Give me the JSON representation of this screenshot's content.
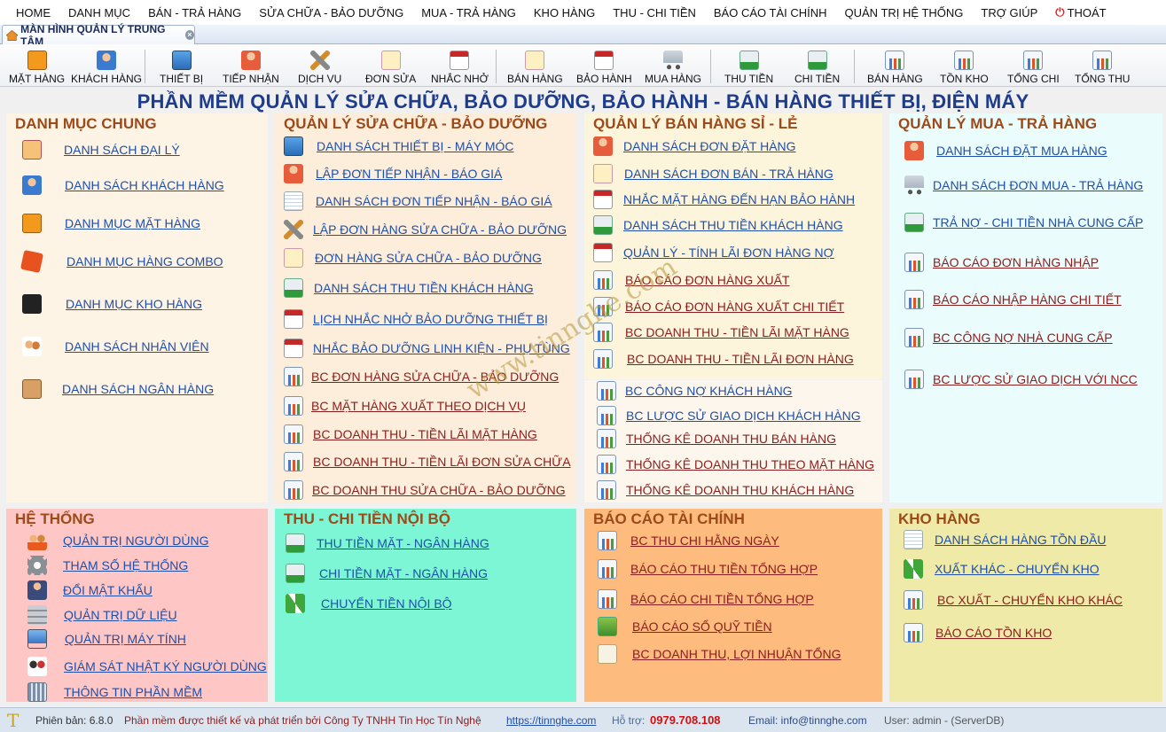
{
  "menu": [
    "HOME",
    "DANH MỤC",
    "BÁN - TRẢ HÀNG",
    "SỬA CHỮA - BẢO DƯỠNG",
    "MUA - TRẢ HÀNG",
    "KHO HÀNG",
    "THU - CHI TIỀN",
    "BÁO CÁO TÀI CHÍNH",
    "QUẢN TRỊ HỆ THỐNG",
    "TRỢ GIÚP",
    "THOÁT"
  ],
  "tab": {
    "title": "MÀN HÌNH QUẢN LÝ TRUNG TÂM",
    "close": "×"
  },
  "toolbar": [
    "MẶT HÀNG",
    "KHÁCH HÀNG",
    "THIẾT BỊ",
    "TIẾP NHẬN",
    "DỊCH VỤ",
    "ĐƠN SỬA",
    "NHẮC NHỞ",
    "BÁN HÀNG",
    "BẢO HÀNH",
    "MUA HÀNG",
    "THU TIỀN",
    "CHI TIỀN",
    "BÁN HÀNG",
    "TỒN KHO",
    "TỔNG CHI",
    "TỔNG THU"
  ],
  "main_title": "PHẦN MỀM QUẢN LÝ SỬA CHỮA, BẢO DƯỠNG, BẢO HÀNH - BÁN HÀNG THIẾT BỊ, ĐIỆN MÁY",
  "panels": {
    "danhmuc": {
      "title": "DANH MỤC CHUNG",
      "items": [
        "DANH SÁCH ĐẠI LÝ",
        "DANH SÁCH KHÁCH HÀNG",
        "DANH MỤC MẶT HÀNG",
        "DANH MỤC HÀNG COMBO",
        "DANH MỤC KHO HÀNG",
        "DANH SÁCH NHÂN VIÊN",
        "DANH SÁCH NGÂN HÀNG"
      ]
    },
    "suachua": {
      "title": "QUẢN LÝ SỬA CHỮA - BẢO DƯỠNG",
      "items": [
        "DANH SÁCH THIẾT BỊ - MÁY MÓC",
        "LẬP ĐƠN TIẾP NHẬN - BÁO GIÁ",
        "DANH SÁCH ĐƠN TIẾP NHẬN - BÁO GIÁ",
        "LẬP ĐƠN HÀNG SỬA CHỮA - BẢO DƯỠNG",
        "ĐƠN HÀNG SỬA CHỮA - BẢO DƯỠNG",
        "DANH SÁCH THU TIỀN KHÁCH HÀNG",
        "LỊCH NHẮC NHỞ BẢO DƯỠNG THIẾT BỊ",
        "NHẮC BẢO DƯỠNG LINH KIỆN - PHỤ TÙNG",
        "BC ĐƠN HÀNG SỬA CHỮA - BẢO DƯỠNG",
        "BC MẶT HÀNG XUẤT THEO DỊCH VỤ",
        "BC DOANH THU - TIỀN LÃI MẶT HÀNG",
        "BC DOANH THU - TIỀN LÃI ĐƠN SỬA CHỮA",
        "BC DOANH THU SỬA CHỮA - BẢO DƯỠNG"
      ]
    },
    "banhang": {
      "title": "QUẢN LÝ BÁN HÀNG SỈ - LẺ",
      "items": [
        "DANH SÁCH ĐƠN ĐẶT HÀNG",
        "DANH SÁCH ĐƠN BÁN - TRẢ HÀNG",
        "NHẮC MẶT HÀNG ĐẾN HẠN BẢO HÀNH",
        "DANH SÁCH THU TIỀN KHÁCH HÀNG",
        "QUẢN LÝ - TÍNH LÃI ĐƠN HÀNG NỢ",
        "BÁO CÁO ĐƠN HÀNG XUẤT",
        "BÁO CÁO ĐƠN HÀNG XUẤT CHI TIẾT",
        "BC DOANH THU - TIỀN LÃI MẶT HÀNG",
        "BC DOANH THU - TIỀN LÃI ĐƠN HÀNG",
        "BC CÔNG NỢ KHÁCH HÀNG",
        "BC LƯỢC SỬ GIAO DỊCH KHÁCH HÀNG",
        "THỐNG KÊ DOANH THU BÁN HÀNG",
        "THỐNG KÊ DOANH THU THEO MẶT HÀNG",
        "THỐNG KÊ DOANH THU KHÁCH HÀNG"
      ]
    },
    "muahang": {
      "title": "QUẢN LÝ MUA - TRẢ HÀNG",
      "items": [
        "DANH SÁCH ĐẶT MUA HÀNG",
        "DANH SÁCH ĐƠN MUA - TRẢ HÀNG",
        "TRẢ NỢ - CHI TIỀN NHÀ CUNG CẤP",
        "BÁO CÁO ĐƠN HÀNG NHẬP",
        "BÁO CÁO NHẬP HÀNG CHI TIẾT",
        "BC CÔNG NỢ NHÀ CUNG CẤP",
        "BC LƯỢC SỬ GIAO DỊCH VỚI NCC"
      ]
    },
    "hethong": {
      "title": "HỆ THỐNG",
      "items": [
        "QUẢN TRỊ NGƯỜI DÙNG",
        "THAM SỐ HỆ THỐNG",
        "ĐỔI MẬT KHẨU",
        "QUẢN TRỊ DỮ LIỆU",
        "QUẢN TRỊ MÁY TÍNH",
        "GIÁM SÁT NHẬT KÝ NGƯỜI DÙNG",
        "THÔNG TIN PHẦN MỀM"
      ]
    },
    "thuchi": {
      "title": "THU - CHI TIỀN NỘI BỘ",
      "items": [
        "THU TIỀN MẶT - NGÂN HÀNG",
        "CHI TIỀN MẶT - NGÂN HÀNG",
        "CHUYỂN TIỀN NỘI BỘ"
      ]
    },
    "baocao": {
      "title": "BÁO CÁO TÀI CHÍNH",
      "items": [
        "BC THU CHI HẰNG NGÀY",
        "BÁO CÁO THU TIỀN TỔNG HỢP",
        "BÁO CÁO CHI TIỀN TỔNG HỢP",
        "BÁO CÁO SỔ QUỸ TIỀN",
        "BC DOANH THU, LỢI NHUẬN TỔNG"
      ]
    },
    "khohang": {
      "title": "KHO HÀNG",
      "items": [
        "DANH SÁCH HÀNG TỒN ĐẦU",
        "XUẤT KHÁC - CHUYỂN KHO",
        "BC XUẤT - CHUYỂN KHO KHÁC",
        "BÁO CÁO TỒN KHO"
      ]
    }
  },
  "status": {
    "version": "Phiên bản: 6.8.0",
    "dev": "Phần mềm được thiết kế và phát triển bởi Công Ty TNHH Tin Học Tín Nghệ",
    "url": "https://tinnghe.com",
    "support_label": "Hỗ trợ:",
    "phone": "0979.708.108",
    "email": "Email: info@tinnghe.com",
    "user": "User: admin - (ServerDB)"
  },
  "watermark": "www.tinnghe.com",
  "colors": {
    "panel_danhmuc": "#fdf4e6",
    "panel_suachua": "#fdeedb",
    "panel_banhang": "#fdf4dc",
    "panel_muahang": "#eafcfb",
    "panel_hethong": "#fec7c5",
    "panel_thuchi": "#7cf6d4",
    "panel_baocao": "#fdbb7d",
    "panel_khohang": "#f0eaa8",
    "title_blue": "#1e3c8c",
    "header_brown": "#9c4a1a"
  }
}
